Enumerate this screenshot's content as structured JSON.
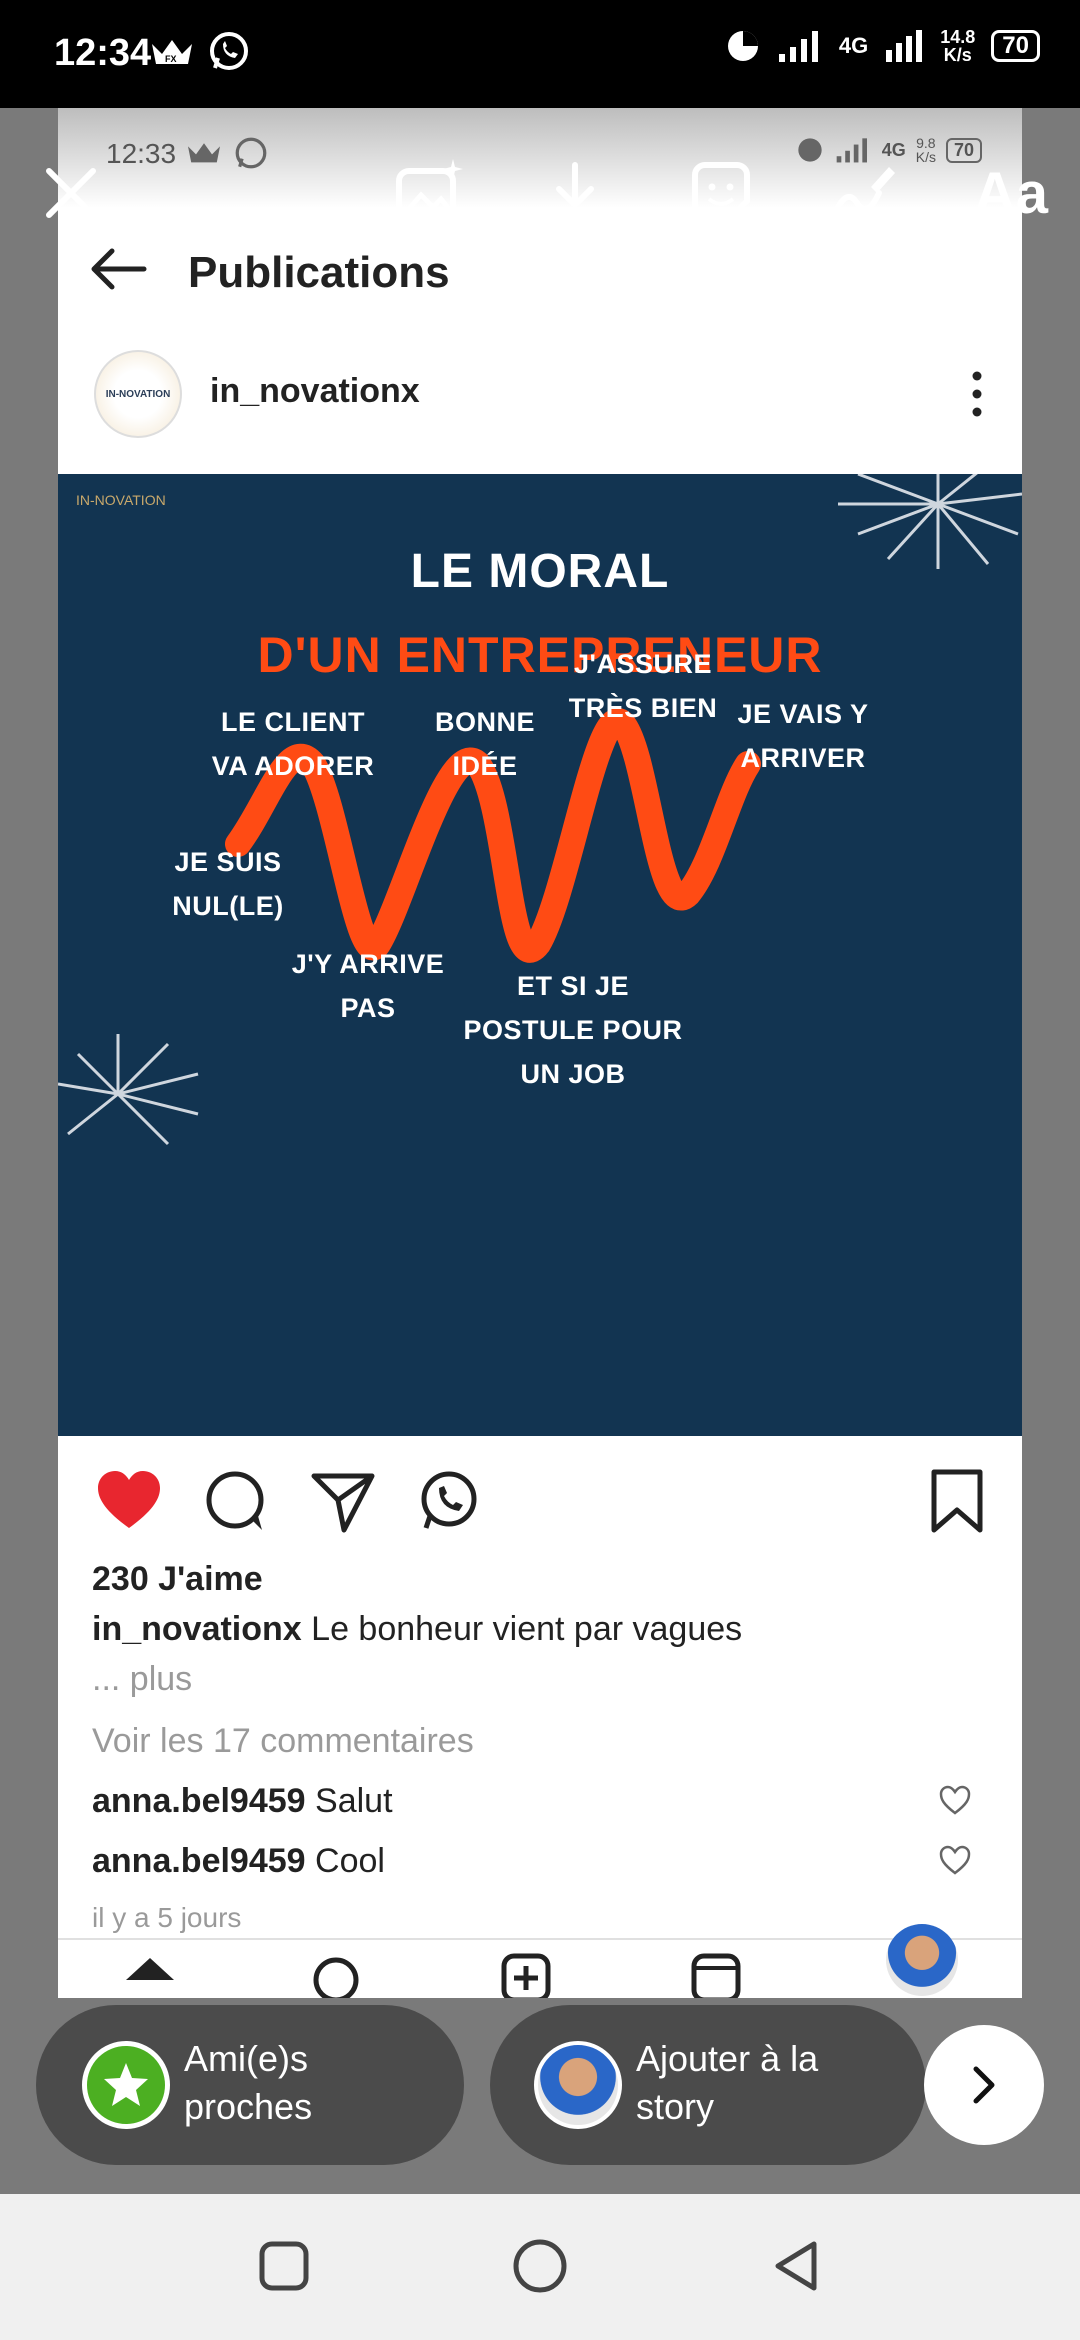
{
  "status_bar": {
    "time": "12:34",
    "network": "4G",
    "speed_value": "14.8",
    "speed_unit": "K/s",
    "battery": "70"
  },
  "story_editor": {
    "tools": [
      "close-icon",
      "image-sparkle-icon",
      "download-icon",
      "sticker-icon",
      "draw-icon",
      "text-tool"
    ],
    "text_tool_label": "Aa"
  },
  "screenshot": {
    "status": {
      "time": "12:33",
      "network": "4G",
      "speed_value": "9.8",
      "speed_unit": "K/s",
      "battery": "70"
    },
    "header": {
      "title": "Publications"
    },
    "post": {
      "username": "in_novationx",
      "avatar_text": "IN-NOVATION",
      "image": {
        "brand": "IN-NOVATION",
        "title_line1": "LE MORAL",
        "title_line2": "D'UN ENTREPRENEUR",
        "accent_color": "#ff4b14",
        "background_color": "#123451",
        "labels": {
          "je_suis_nul_1": "JE SUIS",
          "je_suis_nul_2": "NUL(LE)",
          "client_1": "LE CLIENT",
          "client_2": "VA ADORER",
          "arrive_pas_1": "J'Y ARRIVE",
          "arrive_pas_2": "PAS",
          "bonne_idee_1": "BONNE",
          "bonne_idee_2": "IDÉE",
          "postule_1": "ET SI JE",
          "postule_2": "POSTULE POUR",
          "postule_3": "UN JOB",
          "assure_1": "J'ASSURE",
          "assure_2": "TRÈS BIEN",
          "vais_1": "JE VAIS Y",
          "vais_2": "ARRIVER"
        }
      },
      "likes": "230 J'aime",
      "caption_user": "in_novationx",
      "caption_text": "Le bonheur vient par vagues",
      "more": "... plus",
      "view_comments": "Voir les 17 commentaires",
      "comments": [
        {
          "user": "anna.bel9459",
          "text": "Salut"
        },
        {
          "user": "anna.bel9459",
          "text": "Cool"
        }
      ],
      "time_ago": "il y a 5 jours",
      "liked": true,
      "like_color": "#e8262f"
    }
  },
  "story_controls": {
    "close_friends": "Ami(e)s proches",
    "close_friends_l1": "Ami(e)s",
    "close_friends_l2": "proches",
    "add_story_l1": "Ajouter à la",
    "add_story_l2": "story"
  }
}
